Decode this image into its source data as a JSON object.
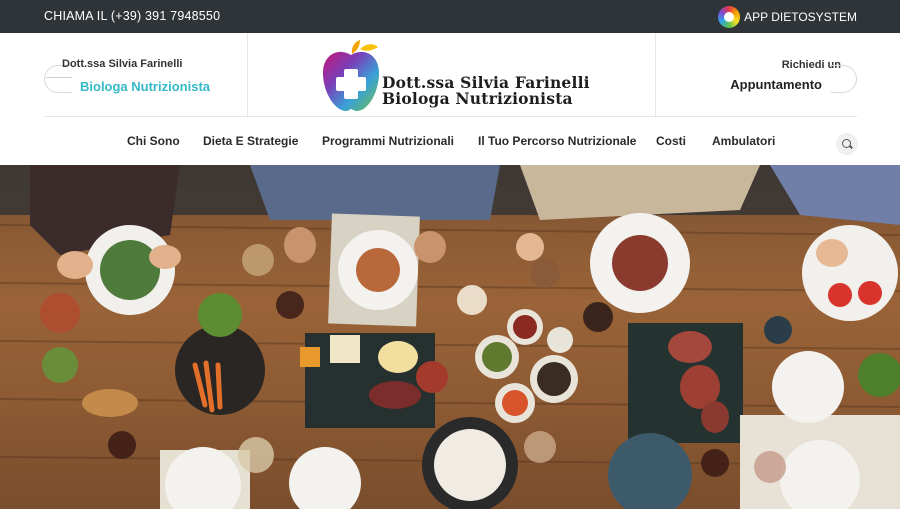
{
  "topbar": {
    "phone": "CHIAMA IL (+39) 391 7948550",
    "app_label": "APP DIETOSYSTEM"
  },
  "header": {
    "left_name": "Dott.ssa Silvia Farinelli",
    "left_role": "Biologa Nutrizionista",
    "logo_line1": "Dott.ssa Silvia Farinelli",
    "logo_line2": "Biologa Nutrizionista",
    "right_small": "Richiedi un",
    "right_big": "Appuntamento"
  },
  "nav": {
    "items": [
      {
        "label": "Chi Sono"
      },
      {
        "label": "Dieta E Strategie"
      },
      {
        "label": "Programmi Nutrizionali"
      },
      {
        "label": "Il Tuo Percorso Nutrizionale"
      },
      {
        "label": "Costi"
      },
      {
        "label": "Ambulatori"
      }
    ],
    "search_icon": "search-icon"
  },
  "colors": {
    "topbar_bg": "#2f3438",
    "accent": "#35b8c8",
    "table_wood": "#9a6338"
  }
}
